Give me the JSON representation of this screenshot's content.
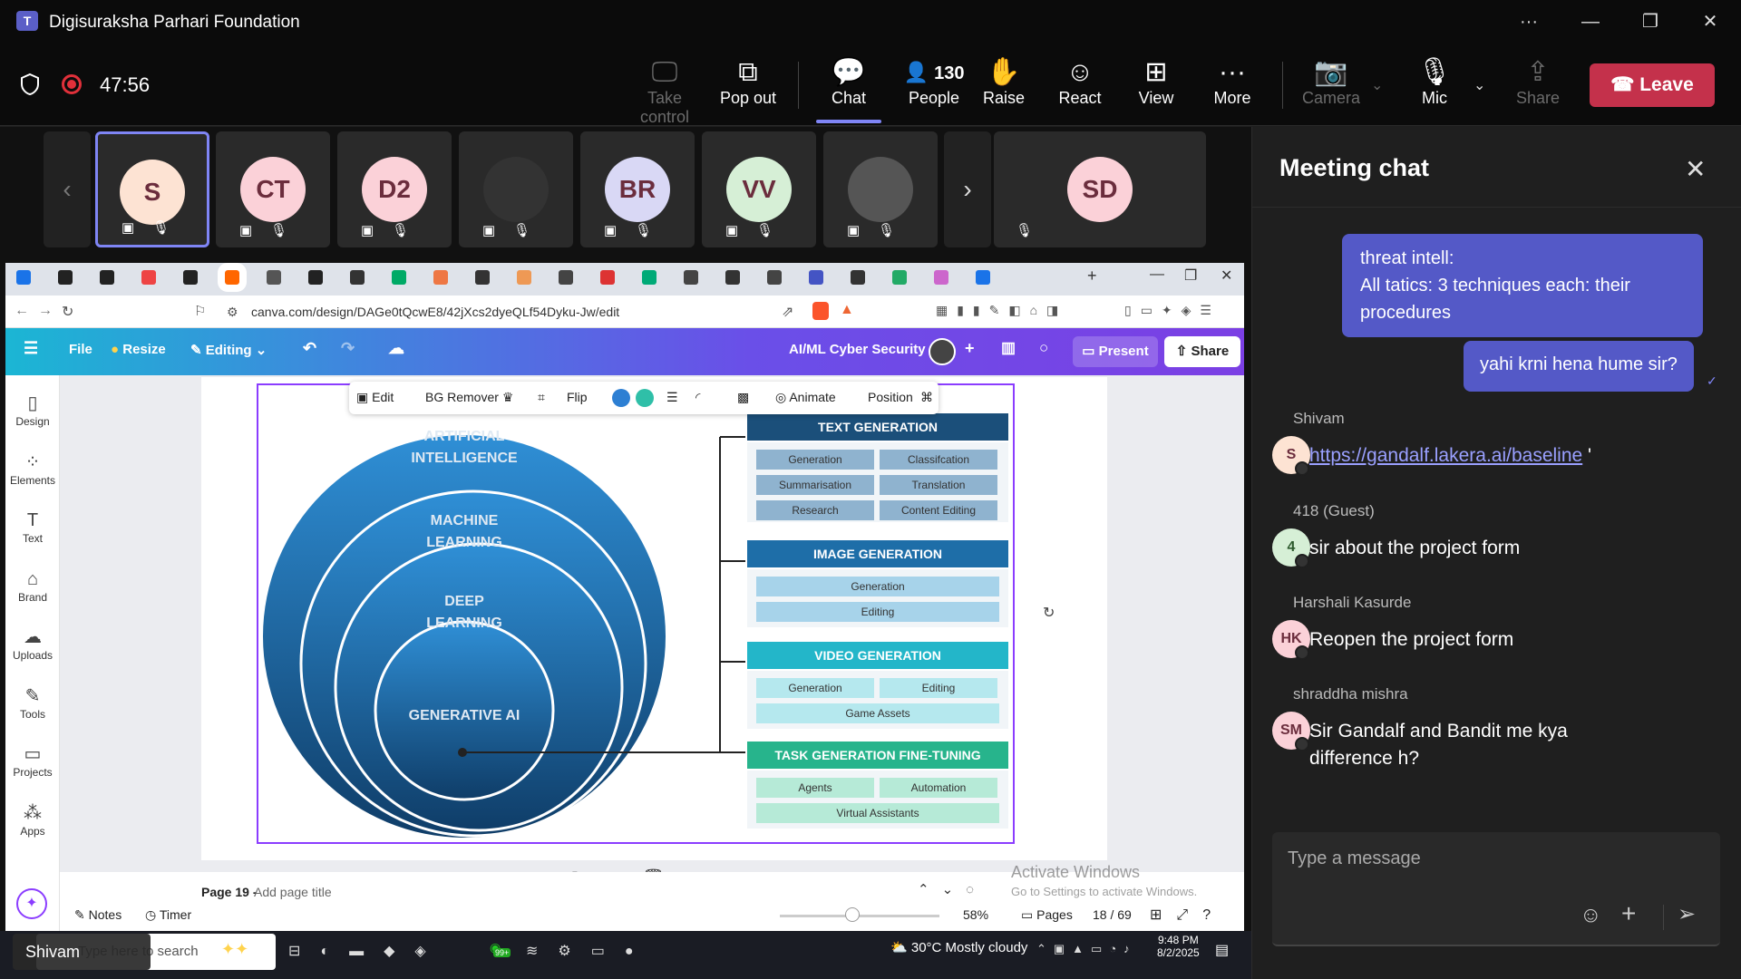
{
  "window": {
    "title": "Digisuraksha Parhari Foundation"
  },
  "meeting": {
    "timer": "47:56",
    "people_count": "130"
  },
  "controls": {
    "take_control": "Take control",
    "pop_out": "Pop out",
    "chat": "Chat",
    "people": "People",
    "raise": "Raise",
    "react": "React",
    "view": "View",
    "more": "More",
    "camera": "Camera",
    "mic": "Mic",
    "share": "Share",
    "leave": "Leave"
  },
  "participants": [
    {
      "initials": "S",
      "bg": "#fde3d3"
    },
    {
      "initials": "CT",
      "bg": "#fbd1d8"
    },
    {
      "initials": "D2",
      "bg": "#fbd1d8"
    },
    {
      "initials": "",
      "bg": "#333"
    },
    {
      "initials": "BR",
      "bg": "#d9d8f5"
    },
    {
      "initials": "VV",
      "bg": "#d6efd6"
    },
    {
      "initials": "",
      "bg": "#555"
    },
    {
      "initials": "SD",
      "bg": "#fbd1d8"
    }
  ],
  "browser": {
    "url": "canva.com/design/DAGe0tQcwE8/42jXcs2dyeQLf54Dyku-Jw/edit"
  },
  "canva": {
    "file": "File",
    "resize": "Resize",
    "editing": "Editing",
    "doc_title": "AI/ML Cyber Security",
    "present": "Present",
    "share": "Share",
    "sidebar": [
      "Design",
      "Elements",
      "Text",
      "Brand",
      "Uploads",
      "Tools",
      "Projects",
      "Apps"
    ],
    "context": {
      "edit": "Edit",
      "bg_remover": "BG Remover",
      "flip": "Flip",
      "animate": "Animate",
      "position": "Position"
    },
    "page_label": "Page 19 -",
    "add_title": "Add page title",
    "notes": "Notes",
    "timer": "Timer",
    "zoom": "58%",
    "pages": "Pages",
    "page_count": "18 / 69"
  },
  "diagram": {
    "circles": [
      "ARTIFICIAL INTELLIGENCE",
      "MACHINE LEARNING",
      "DEEP LEARNING",
      "GENERATIVE AI"
    ],
    "groups": [
      {
        "title": "TEXT GENERATION",
        "head": "#1b4f7a",
        "cell": "#8fb3cf",
        "items": [
          "Generation",
          "Classifcation",
          "Summarisation",
          "Translation",
          "Research",
          "Content Editing"
        ]
      },
      {
        "title": "IMAGE GENERATION",
        "head": "#1e6ea8",
        "cell": "#a7d3ea",
        "items": [
          "Generation",
          "Editing"
        ]
      },
      {
        "title": "VIDEO GENERATION",
        "head": "#23b6c9",
        "cell": "#b5e8ee",
        "items": [
          "Generation",
          "Editing",
          "Game Assets"
        ]
      },
      {
        "title": "TASK GENERATION FINE-TUNING",
        "head": "#27b48c",
        "cell": "#b6ead7",
        "items": [
          "Agents",
          "Automation",
          "Virtual Assistants"
        ]
      }
    ]
  },
  "watermark": {
    "line1": "Activate Windows",
    "line2": "Go to Settings to activate Windows."
  },
  "taskbar": {
    "user": "Shivam",
    "search": "Type here to search",
    "weather": "30°C  Mostly cloudy",
    "time": "9:48 PM",
    "date": "8/2/2025",
    "badge": "99+"
  },
  "chat": {
    "title": "Meeting chat",
    "own": [
      {
        "text": "threat intell:\nAll tatics: 3 techniques each: their procedures"
      },
      {
        "text": "yahi krni hena hume sir?"
      }
    ],
    "messages": [
      {
        "sender": "Shivam",
        "initials": "S",
        "bg": "#fde3d3",
        "fg": "#6b2d3d",
        "text": "https://gandalf.lakera.ai/baseline",
        "suffix": " '"
      },
      {
        "sender": "418 (Guest)",
        "initials": "4",
        "bg": "#d6efd6",
        "fg": "#2d5a2d",
        "text": "sir about the project form"
      },
      {
        "sender": "Harshali Kasurde",
        "initials": "HK",
        "bg": "#fbd1d8",
        "fg": "#6b2d3d",
        "text": "Reopen the project form"
      },
      {
        "sender": "shraddha mishra",
        "initials": "SM",
        "bg": "#fbd1d8",
        "fg": "#6b2d3d",
        "text": "Sir Gandalf and Bandit me kya difference h?"
      }
    ],
    "placeholder": "Type a message"
  }
}
